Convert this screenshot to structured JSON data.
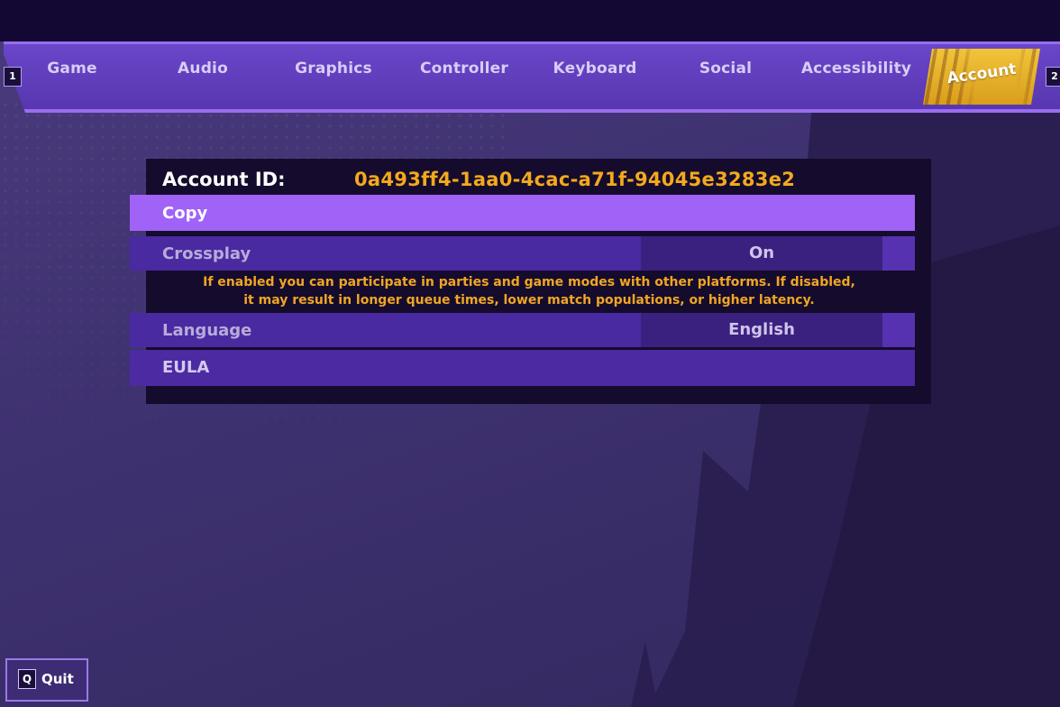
{
  "tabs": [
    {
      "label": "Game"
    },
    {
      "label": "Audio"
    },
    {
      "label": "Graphics"
    },
    {
      "label": "Controller"
    },
    {
      "label": "Keyboard"
    },
    {
      "label": "Social"
    },
    {
      "label": "Accessibility"
    },
    {
      "label": "Account"
    }
  ],
  "active_tab": "Account",
  "key_hints": {
    "prev": "1",
    "next": "2"
  },
  "account": {
    "id_label": "Account ID:",
    "id_value": "0a493ff4-1aa0-4cac-a71f-94045e3283e2",
    "copy_label": "Copy"
  },
  "settings": {
    "crossplay": {
      "label": "Crossplay",
      "value": "On",
      "description_line1": "If enabled you can participate in parties and game modes with other platforms. If disabled,",
      "description_line2": "it may result in longer queue times, lower match populations, or higher latency."
    },
    "language": {
      "label": "Language",
      "value": "English"
    },
    "eula": {
      "label": "EULA"
    }
  },
  "footer": {
    "quit_key": "Q",
    "quit_label": "Quit"
  },
  "colors": {
    "accent_purple": "#a062f7",
    "active_tab_gold": "#f2c43a",
    "highlight_orange": "#f3a91d",
    "panel_bg": "#150b2c"
  }
}
